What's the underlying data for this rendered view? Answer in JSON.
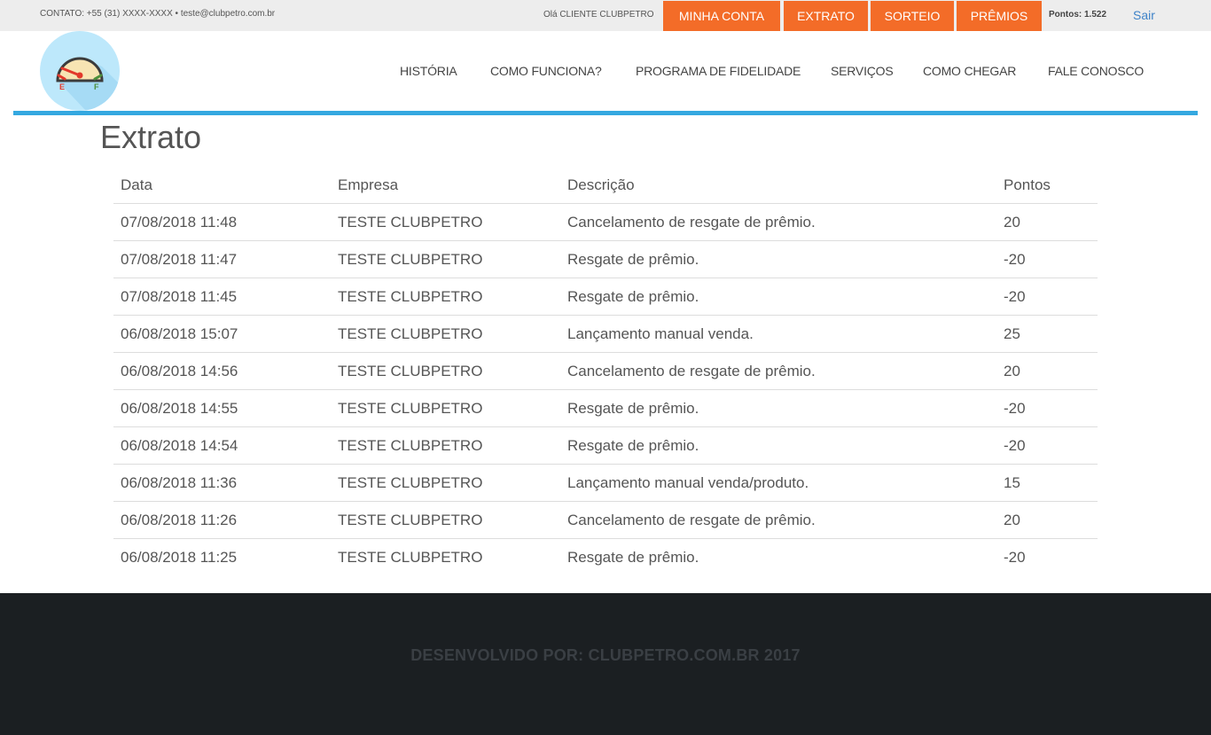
{
  "topbar": {
    "contact": "CONTATO: +55 (31) XXXX-XXXX • teste@clubpetro.com.br",
    "greeting": "Olá CLIENTE CLUBPETRO",
    "buttons": [
      {
        "label": "MINHA CONTA"
      },
      {
        "label": "EXTRATO"
      },
      {
        "label": "SORTEIO"
      },
      {
        "label": "PRÊMIOS"
      }
    ],
    "points": "Pontos: 1.522",
    "logout": "Sair"
  },
  "logo": {
    "icon": "fuel-gauge-icon",
    "empty_label": "E",
    "full_label": "F",
    "colors": {
      "background": "#bde8fb",
      "dial": "#f7e4b3",
      "needle": "#e2382b",
      "full_mark": "#4c8f3a"
    }
  },
  "nav": {
    "items": [
      {
        "label": "HISTÓRIA"
      },
      {
        "label": "COMO FUNCIONA?"
      },
      {
        "label": "PROGRAMA DE FIDELIDADE"
      },
      {
        "label": "SERVIÇOS"
      },
      {
        "label": "COMO CHEGAR"
      },
      {
        "label": "FALE CONOSCO"
      }
    ]
  },
  "main": {
    "title": "Extrato",
    "table": {
      "headers": {
        "date": "Data",
        "company": "Empresa",
        "description": "Descrição",
        "points": "Pontos"
      },
      "rows": [
        {
          "date": "07/08/2018 11:48",
          "company": "TESTE CLUBPETRO",
          "description": "Cancelamento de resgate de prêmio.",
          "points": "20"
        },
        {
          "date": "07/08/2018 11:47",
          "company": "TESTE CLUBPETRO",
          "description": "Resgate de prêmio.",
          "points": "-20"
        },
        {
          "date": "07/08/2018 11:45",
          "company": "TESTE CLUBPETRO",
          "description": "Resgate de prêmio.",
          "points": "-20"
        },
        {
          "date": "06/08/2018 15:07",
          "company": "TESTE CLUBPETRO",
          "description": "Lançamento manual venda.",
          "points": "25"
        },
        {
          "date": "06/08/2018 14:56",
          "company": "TESTE CLUBPETRO",
          "description": "Cancelamento de resgate de prêmio.",
          "points": "20"
        },
        {
          "date": "06/08/2018 14:55",
          "company": "TESTE CLUBPETRO",
          "description": "Resgate de prêmio.",
          "points": "-20"
        },
        {
          "date": "06/08/2018 14:54",
          "company": "TESTE CLUBPETRO",
          "description": "Resgate de prêmio.",
          "points": "-20"
        },
        {
          "date": "06/08/2018 11:36",
          "company": "TESTE CLUBPETRO",
          "description": "Lançamento manual venda/produto.",
          "points": "15"
        },
        {
          "date": "06/08/2018 11:26",
          "company": "TESTE CLUBPETRO",
          "description": "Cancelamento de resgate de prêmio.",
          "points": "20"
        },
        {
          "date": "06/08/2018 11:25",
          "company": "TESTE CLUBPETRO",
          "description": "Resgate de prêmio.",
          "points": "-20"
        }
      ]
    }
  },
  "footer": {
    "text": "DESENVOLVIDO POR: CLUBPETRO.COM.BR 2017"
  },
  "colors": {
    "accent_orange": "#f36c28",
    "header_line_blue": "#34a8e0",
    "link_blue": "#3f83c8",
    "footer_bg": "#1b1f22"
  }
}
